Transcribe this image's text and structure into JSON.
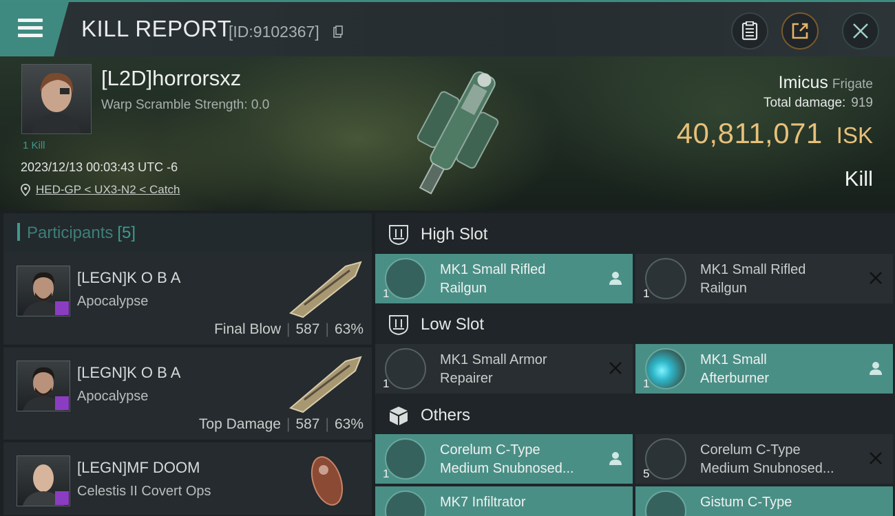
{
  "header": {
    "title": "KILL REPORT",
    "report_id": "[ID:9102367]"
  },
  "victim": {
    "name": "[L2D]horrorsxz",
    "warp_scramble": "Warp Scramble Strength: 0.0",
    "kill_count": "1 Kill",
    "datetime": "2023/12/13 00:03:43 UTC -6",
    "location": "HED-GP < UX3-N2 < Catch",
    "ship_name": "Imicus",
    "ship_class": "Frigate",
    "total_damage_label": "Total damage:",
    "total_damage": "919",
    "isk_value": "40,811,071",
    "isk_unit": "ISK",
    "result": "Kill"
  },
  "participants": {
    "title": "Participants",
    "count": "[5]",
    "rows": [
      {
        "name": "[LEGN]K O B A",
        "ship": "Apocalypse",
        "role": "Final Blow",
        "damage": "587",
        "percent": "63%"
      },
      {
        "name": "[LEGN]K O B A",
        "ship": "Apocalypse",
        "role": "Top Damage",
        "damage": "587",
        "percent": "63%"
      },
      {
        "name": "[LEGN]MF DOOM",
        "ship": "Celestis II Covert Ops",
        "role": "",
        "damage": "",
        "percent": ""
      }
    ]
  },
  "fittings": {
    "high_slot": {
      "title": "High Slot",
      "items": [
        {
          "line1": "MK1 Small Rifled",
          "line2": "Railgun",
          "qty": "1",
          "status": "dropped"
        },
        {
          "line1": "MK1 Small Rifled",
          "line2": "Railgun",
          "qty": "1",
          "status": "destroyed"
        }
      ]
    },
    "low_slot": {
      "title": "Low Slot",
      "items": [
        {
          "line1": "MK1 Small Armor",
          "line2": "Repairer",
          "qty": "1",
          "status": "destroyed"
        },
        {
          "line1": "MK1 Small",
          "line2": "Afterburner",
          "qty": "1",
          "status": "dropped"
        }
      ]
    },
    "others": {
      "title": "Others",
      "items": [
        {
          "line1": "Corelum C-Type",
          "line2": "Medium Snubnosed...",
          "qty": "1",
          "status": "dropped"
        },
        {
          "line1": "Corelum C-Type",
          "line2": "Medium Snubnosed...",
          "qty": "5",
          "status": "destroyed"
        },
        {
          "line1": "MK7 Infiltrator",
          "line2": "",
          "qty": "",
          "status": "dropped"
        },
        {
          "line1": "Gistum C-Type",
          "line2": "",
          "qty": "",
          "status": "dropped"
        }
      ]
    }
  },
  "colors": {
    "accent": "#3f9a8a",
    "isk": "#e7c07a",
    "dropped_bg": "#4a8f86",
    "destroyed_bg": "#282e31",
    "corp_badge": "#8b3dc2"
  },
  "icons": [
    "menu-icon",
    "copy-icon",
    "clipboard-icon",
    "share-icon",
    "close-icon",
    "location-pin-icon",
    "high-slot-icon",
    "low-slot-icon",
    "others-icon",
    "dropped-icon",
    "destroyed-icon"
  ]
}
